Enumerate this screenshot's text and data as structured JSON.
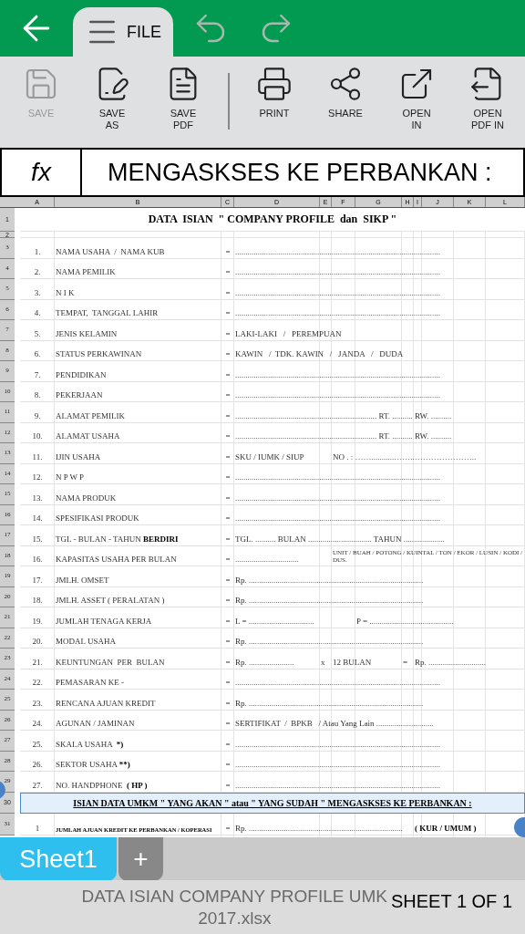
{
  "top_bar": {
    "file_tab": {
      "label": "FILE",
      "selected": true
    }
  },
  "ribbon": [
    {
      "label": "SAVE",
      "disabled": true
    },
    {
      "label": "SAVE AS",
      "disabled": false
    },
    {
      "label": "SAVE PDF",
      "disabled": false
    },
    {
      "label": "PRINT",
      "disabled": false
    },
    {
      "label": "SHARE",
      "disabled": false
    },
    {
      "label": "OPEN IN",
      "disabled": false
    },
    {
      "label": "OPEN PDF IN",
      "disabled": false
    }
  ],
  "formula_bar": {
    "fx": "fx",
    "content": "MENGASKSES KE PERBANKAN :"
  },
  "column_headers": [
    "A",
    "B",
    "C",
    "D",
    "E",
    "F",
    "G",
    "H",
    "I",
    "J",
    "K",
    "L"
  ],
  "row_headers": [
    "1",
    "2",
    "3",
    "4",
    "5",
    "6",
    "7",
    "8",
    "9",
    "10",
    "11",
    "12",
    "13",
    "14",
    "15",
    "16",
    "17",
    "18",
    "19",
    "20",
    "21",
    "22",
    "23",
    "24",
    "25",
    "26",
    "27",
    "28",
    "29",
    "30",
    "31"
  ],
  "title": "DATA  ISIAN  \" COMPANY PROFILE  dan  SIKP \"",
  "rows": [
    {
      "no": "1.",
      "label": "NAMA USAHA  /  NAMA KUB",
      "eq": "=",
      "values": [
        {
          "text": "...................................................................................................."
        }
      ]
    },
    {
      "no": "2.",
      "label": "NAMA PEMILIK",
      "eq": "=",
      "values": [
        {
          "text": "...................................................................................................."
        }
      ]
    },
    {
      "no": "3.",
      "label": "N I K",
      "eq": "=",
      "values": [
        {
          "text": "...................................................................................................."
        }
      ]
    },
    {
      "no": "4.",
      "label": "TEMPAT,  TANGGAL LAHIR",
      "eq": "=",
      "values": [
        {
          "text": "...................................................................................................."
        }
      ]
    },
    {
      "no": "5.",
      "label": "JENIS KELAMIN",
      "eq": "=",
      "values": [
        {
          "text": "LAKI-LAKI   /   PEREMPUAN"
        }
      ]
    },
    {
      "no": "6.",
      "label": "STATUS PERKAWINAN",
      "eq": "=",
      "values": [
        {
          "text": "KAWIN   /  TDK. KAWIN   /   JANDA   /   DUDA"
        }
      ]
    },
    {
      "no": "7.",
      "label": "PENDIDIKAN",
      "eq": "=",
      "values": [
        {
          "text": "...................................................................................................."
        }
      ]
    },
    {
      "no": "8.",
      "label": "PEKERJAAN",
      "eq": "=",
      "values": [
        {
          "text": "...................................................................................................."
        }
      ]
    },
    {
      "no": "9.",
      "label": "ALAMAT PEMILIK",
      "eq": "=",
      "values": [
        {
          "text": "..................................................................... RT. .......... RW. .........."
        }
      ]
    },
    {
      "no": "10.",
      "label": "ALAMAT USAHA",
      "eq": "=",
      "values": [
        {
          "text": "..................................................................... RT. .......... RW. .........."
        }
      ]
    },
    {
      "no": "11.",
      "label": "IJIN USAHA",
      "eq": "=",
      "values": [
        {
          "text": "SKU / IUMK / SIUP"
        },
        {
          "text": "NO . : ……...........……..………………….."
        }
      ]
    },
    {
      "no": "12.",
      "label": "N P W P",
      "eq": "=",
      "values": [
        {
          "text": "...................................................................................................."
        }
      ]
    },
    {
      "no": "13.",
      "label": "NAMA PRODUK",
      "eq": "=",
      "values": [
        {
          "text": "...................................................................................................."
        }
      ]
    },
    {
      "no": "14.",
      "label": "SPESIFIKASI PRODUK",
      "eq": "=",
      "values": [
        {
          "text": "...................................................................................................."
        }
      ]
    },
    {
      "no": "15.",
      "label": "TGL - BULAN - TAHUN ",
      "label_bold": "BERDIRI",
      "eq": "=",
      "values": [
        {
          "text": "TGL. .......... BULAN ............................... TAHUN ...................."
        }
      ]
    },
    {
      "no": "16.",
      "label": "KAPASITAS USAHA PER BULAN",
      "eq": "=",
      "values": [
        {
          "text": "..............................."
        },
        {
          "text": "UNIT / BUAH / POTONG / KUINTAL / TON / EKOR / LUSIN / KODI / DUS.",
          "small": true
        }
      ]
    },
    {
      "no": "17.",
      "label": "JMLH. OMSET",
      "eq": "=",
      "values": [
        {
          "text": "Rp. ....................................................................................."
        }
      ]
    },
    {
      "no": "18.",
      "label": "JMLH. ASSET ( PERALATAN )",
      "eq": "=",
      "values": [
        {
          "text": "Rp. ....................................................................................."
        }
      ]
    },
    {
      "no": "19.",
      "label": "JUMLAH TENAGA KERJA",
      "eq": "=",
      "values": [
        {
          "text": "L = ................................"
        },
        {
          "text": "P = ........................................."
        }
      ]
    },
    {
      "no": "20.",
      "label": "MODAL USAHA",
      "eq": "=",
      "values": [
        {
          "text": "Rp. ....................................................................................."
        }
      ]
    },
    {
      "no": "21.",
      "label": "KEUNTUNGAN  PER  BULAN",
      "eq": "=",
      "values": [
        {
          "text": "Rp. ......................"
        },
        {
          "text": "x"
        },
        {
          "text": "12 BULAN"
        },
        {
          "text": "="
        },
        {
          "text": "Rp. ............................"
        }
      ]
    },
    {
      "no": "22.",
      "label": "PEMASARAN KE -",
      "eq": "=",
      "values": [
        {
          "text": "...................................................................................................."
        }
      ]
    },
    {
      "no": "23.",
      "label": "RENCANA AJUAN KREDIT",
      "eq": "=",
      "values": [
        {
          "text": "Rp. ....................................................................................."
        }
      ]
    },
    {
      "no": "24.",
      "label": "AGUNAN / JAMINAN",
      "eq": "=",
      "values": [
        {
          "text": "SERTIFIKAT  /  BPKB   / Atau Yang Lain ............................"
        }
      ]
    },
    {
      "no": "25.",
      "label": "SKALA USAHA  ",
      "label_bold": "*)",
      "eq": "=",
      "values": [
        {
          "text": "...................................................................................................."
        }
      ]
    },
    {
      "no": "26.",
      "label": "SEKTOR USAHA ",
      "label_bold": "**)",
      "eq": "=",
      "values": [
        {
          "text": "...................................................................................................."
        }
      ]
    },
    {
      "no": "27.",
      "label": "NO. HANDPHONE  ",
      "label_bold": "( HP )",
      "eq": "=",
      "values": [
        {
          "text": "...................................................................................................."
        }
      ]
    }
  ],
  "section": {
    "text": "ISIAN DATA UMKM \" YANG AKAN \" atau \" YANG SUDAH \" MENGASKSES KE PERBANKAN :",
    "selected": true
  },
  "loan_row": {
    "no": "1",
    "label": "JUMLAH AJUAN KREDIT KE PERBANKAN / KOPERASI",
    "eq": "=",
    "values": [
      {
        "text": "Rp. ..........................................................................."
      },
      {
        "text": "( KUR / UMUM )",
        "bold": true
      }
    ]
  },
  "sheet_tabs": [
    {
      "label": "Sheet1",
      "selected": true
    }
  ],
  "add_sheet": "+",
  "footer": {
    "filename_lines": [
      "DATA ISIAN COMPANY PROFILE UMK",
      "2017.xlsx"
    ],
    "sheet_count": "SHEET 1 OF 1"
  }
}
